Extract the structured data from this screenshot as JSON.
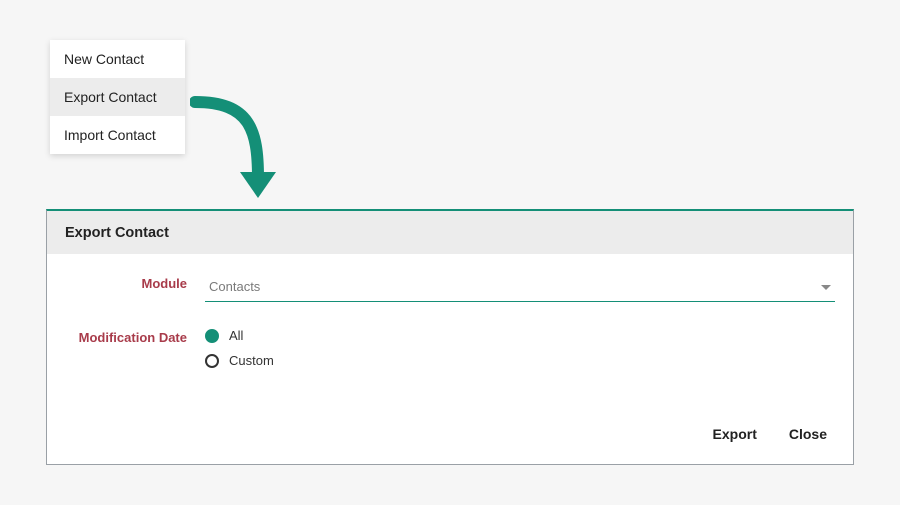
{
  "menu": {
    "items": [
      {
        "label": "New Contact",
        "selected": false
      },
      {
        "label": "Export Contact",
        "selected": true
      },
      {
        "label": "Import Contact",
        "selected": false
      }
    ]
  },
  "panel": {
    "title": "Export Contact",
    "fields": {
      "module": {
        "label": "Module",
        "value": "Contacts"
      },
      "modification_date": {
        "label": "Modification Date",
        "options": [
          {
            "label": "All",
            "selected": true
          },
          {
            "label": "Custom",
            "selected": false
          }
        ]
      }
    },
    "buttons": {
      "export": "Export",
      "close": "Close"
    }
  },
  "colors": {
    "accent": "#148f77",
    "field_label": "#a83b4a"
  }
}
